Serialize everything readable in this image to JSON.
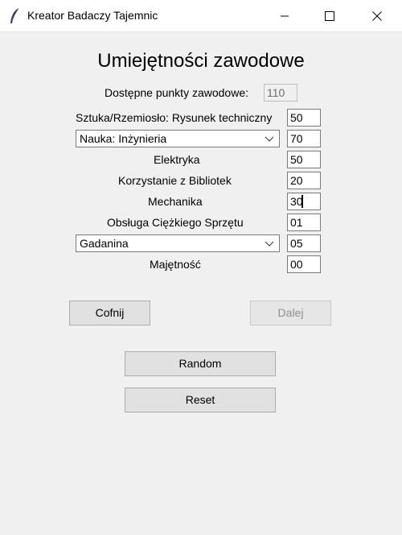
{
  "window": {
    "title": "Kreator Badaczy Tajemnic"
  },
  "heading": "Umiejętności zawodowe",
  "points": {
    "label": "Dostępne punkty zawodowe:",
    "value": "110"
  },
  "skills": [
    {
      "label": "Sztuka/Rzemiosło: Rysunek techniczny",
      "value": "50"
    },
    {
      "select": "Nauka: Inżynieria",
      "value": "70"
    },
    {
      "label": "Elektryka",
      "value": "50"
    },
    {
      "label": "Korzystanie z Bibliotek",
      "value": "20"
    },
    {
      "label": "Mechanika",
      "value": "30"
    },
    {
      "label": "Obsługa Ciężkiego Sprzętu",
      "value": "01"
    },
    {
      "select": "Gadanina",
      "value": "05"
    },
    {
      "label": "Majętność",
      "value": "00"
    }
  ],
  "buttons": {
    "back": "Cofnij",
    "next": "Dalej",
    "random": "Random",
    "reset": "Reset"
  }
}
